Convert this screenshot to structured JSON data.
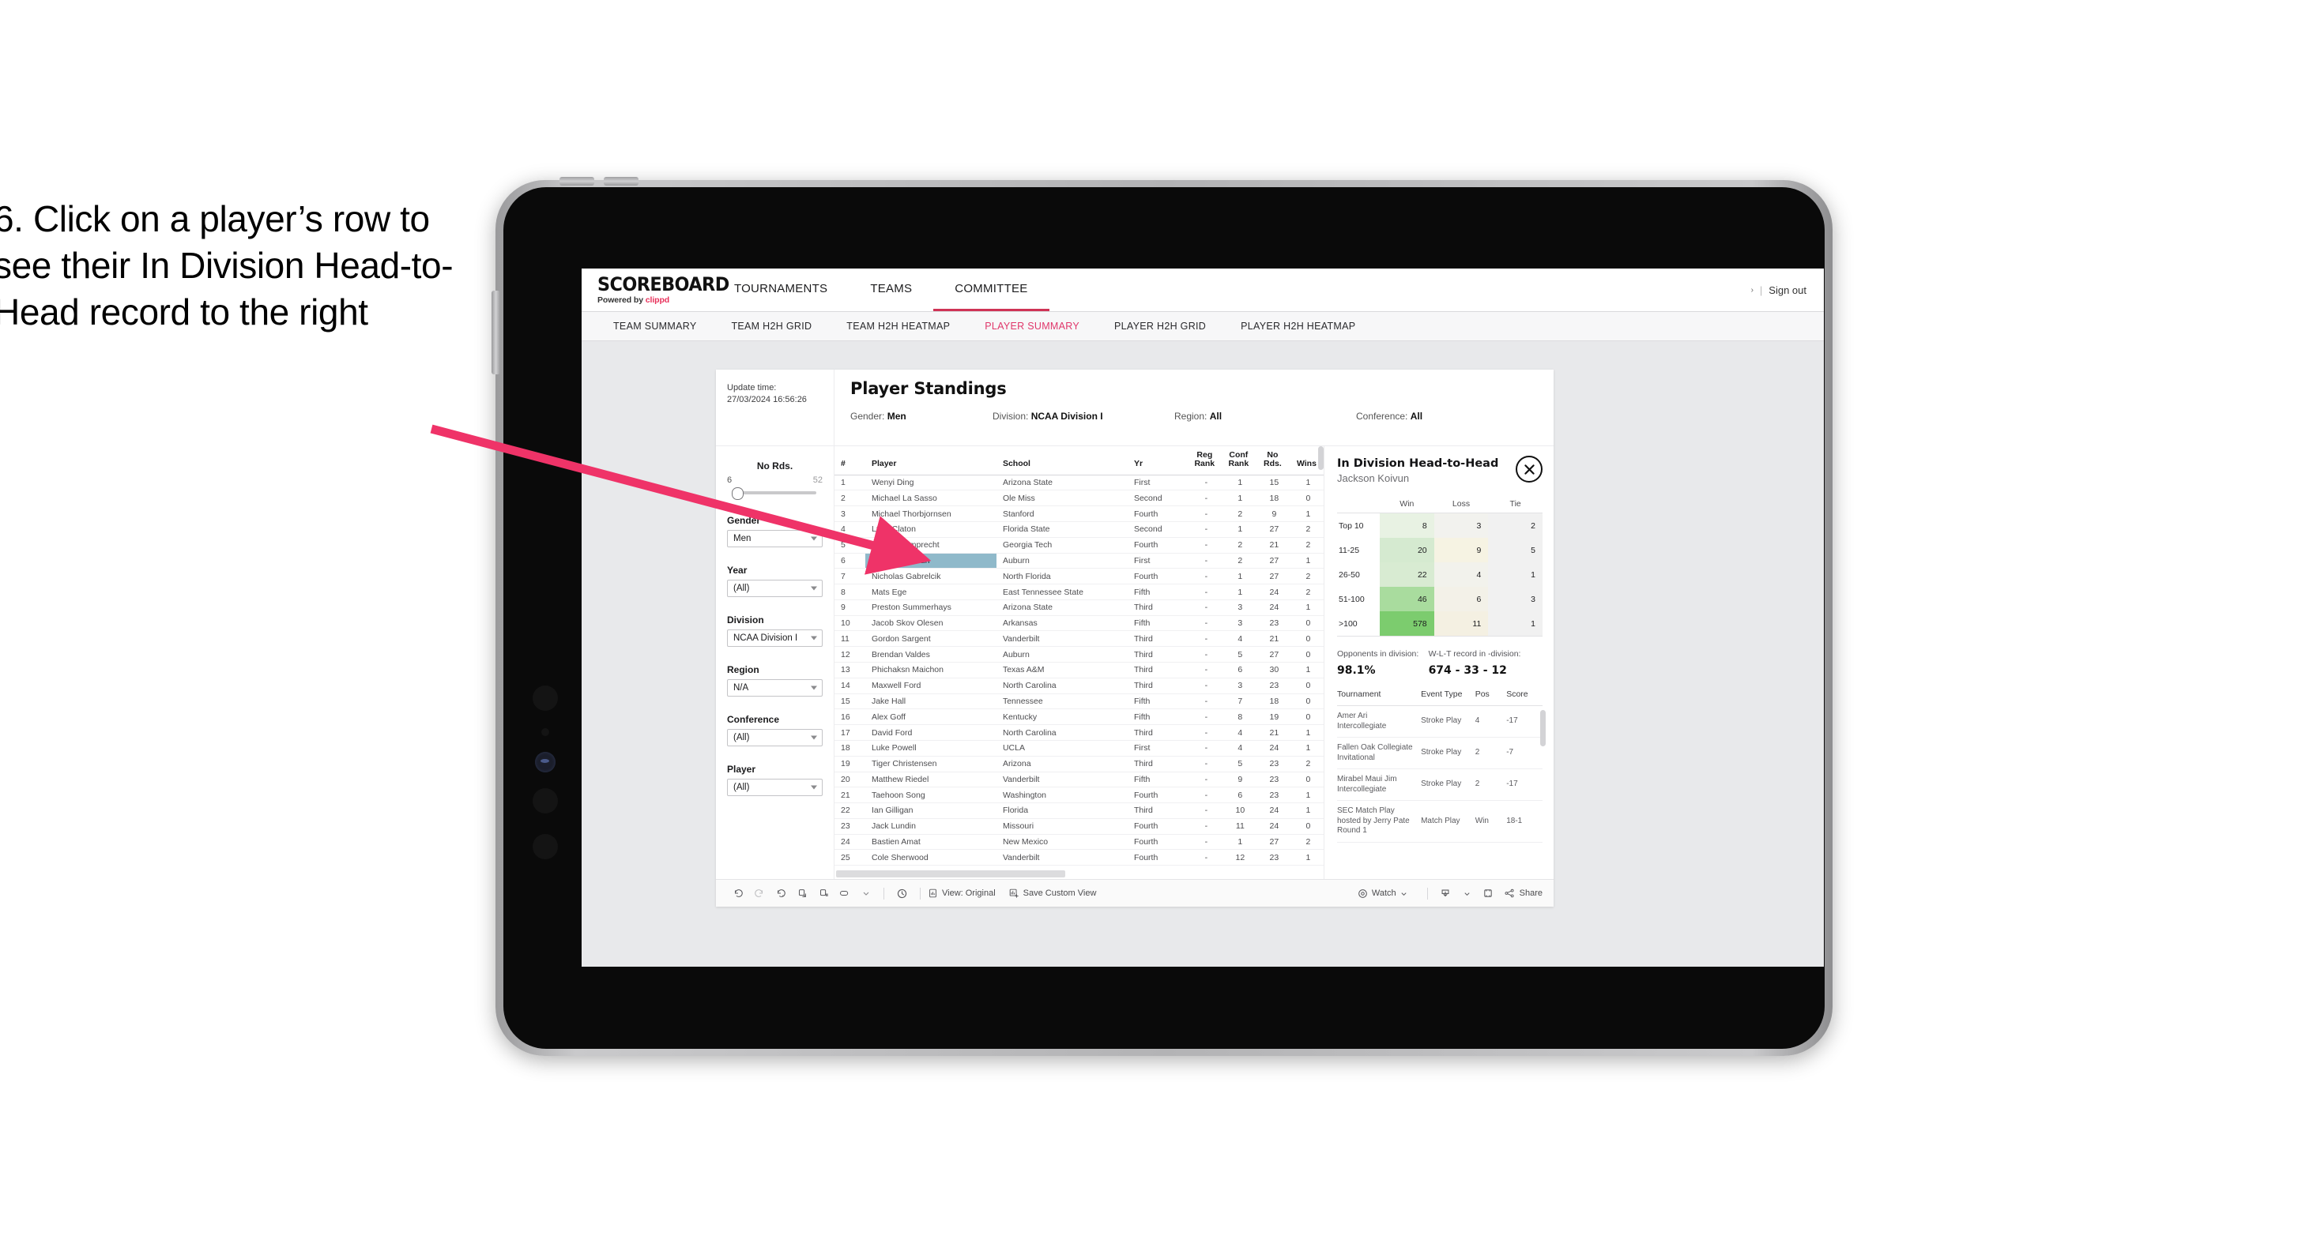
{
  "instruction": "6. Click on a player’s row to see their In Division Head-to-Head record to the right",
  "app": {
    "brand": {
      "name": "SCOREBOARD",
      "powered_prefix": "Powered by ",
      "powered_brand": "clippd"
    },
    "top_nav": [
      {
        "label": "TOURNAMENTS",
        "active": false
      },
      {
        "label": "TEAMS",
        "active": false
      },
      {
        "label": "COMMITTEE",
        "active": true
      }
    ],
    "account": {
      "chevron": "›",
      "separator": "|",
      "sign_out": "Sign out"
    },
    "sub_nav": [
      {
        "label": "TEAM SUMMARY",
        "active": false
      },
      {
        "label": "TEAM H2H GRID",
        "active": false
      },
      {
        "label": "TEAM H2H HEATMAP",
        "active": false
      },
      {
        "label": "PLAYER SUMMARY",
        "active": true
      },
      {
        "label": "PLAYER H2H GRID",
        "active": false
      },
      {
        "label": "PLAYER H2H HEATMAP",
        "active": false
      }
    ]
  },
  "card": {
    "update_time_label": "Update time:",
    "update_time_value": "27/03/2024 16:56:26",
    "title": "Player Standings",
    "crumbs": [
      {
        "key": "Gender: ",
        "value": "Men"
      },
      {
        "key": "Division: ",
        "value": "NCAA Division I"
      },
      {
        "key": "Region: ",
        "value": "All"
      },
      {
        "key": "Conference: ",
        "value": "All"
      }
    ]
  },
  "filters": {
    "slider": {
      "label": "No Rds.",
      "min": "6",
      "max": "52"
    },
    "selects": [
      {
        "label": "Gender",
        "value": "Men"
      },
      {
        "label": "Year",
        "value": "(All)"
      },
      {
        "label": "Division",
        "value": "NCAA Division I"
      },
      {
        "label": "Region",
        "value": "N/A"
      },
      {
        "label": "Conference",
        "value": "(All)"
      },
      {
        "label": "Player",
        "value": "(All)"
      }
    ]
  },
  "standings": {
    "columns": [
      "#",
      "Player",
      "School",
      "Yr",
      "Reg Rank",
      "Conf Rank",
      "No Rds.",
      "Wins"
    ],
    "column_lines": [
      [
        "#",
        ""
      ],
      [
        "Player",
        ""
      ],
      [
        "School",
        ""
      ],
      [
        "Yr",
        ""
      ],
      [
        "Reg",
        "Rank"
      ],
      [
        "Conf",
        "Rank"
      ],
      [
        "No",
        "Rds."
      ],
      [
        "Wins",
        ""
      ]
    ],
    "rows": [
      {
        "n": "1",
        "player": "Wenyi Ding",
        "school": "Arizona State",
        "yr": "First",
        "reg": "-",
        "conf": "1",
        "rds": "15",
        "wins": "1",
        "selected": false
      },
      {
        "n": "2",
        "player": "Michael La Sasso",
        "school": "Ole Miss",
        "yr": "Second",
        "reg": "-",
        "conf": "1",
        "rds": "18",
        "wins": "0",
        "selected": false
      },
      {
        "n": "3",
        "player": "Michael Thorbjornsen",
        "school": "Stanford",
        "yr": "Fourth",
        "reg": "-",
        "conf": "2",
        "rds": "9",
        "wins": "1",
        "selected": false
      },
      {
        "n": "4",
        "player": "Luke Claton",
        "school": "Florida State",
        "yr": "Second",
        "reg": "-",
        "conf": "1",
        "rds": "27",
        "wins": "2",
        "selected": false
      },
      {
        "n": "5",
        "player": "Christo Lamprecht",
        "school": "Georgia Tech",
        "yr": "Fourth",
        "reg": "-",
        "conf": "2",
        "rds": "21",
        "wins": "2",
        "selected": false
      },
      {
        "n": "6",
        "player": "Jackson Koivun",
        "school": "Auburn",
        "yr": "First",
        "reg": "-",
        "conf": "2",
        "rds": "27",
        "wins": "1",
        "selected": true
      },
      {
        "n": "7",
        "player": "Nicholas Gabrelcik",
        "school": "North Florida",
        "yr": "Fourth",
        "reg": "-",
        "conf": "1",
        "rds": "27",
        "wins": "2",
        "selected": false
      },
      {
        "n": "8",
        "player": "Mats Ege",
        "school": "East Tennessee State",
        "yr": "Fifth",
        "reg": "-",
        "conf": "1",
        "rds": "24",
        "wins": "2",
        "selected": false
      },
      {
        "n": "9",
        "player": "Preston Summerhays",
        "school": "Arizona State",
        "yr": "Third",
        "reg": "-",
        "conf": "3",
        "rds": "24",
        "wins": "1",
        "selected": false
      },
      {
        "n": "10",
        "player": "Jacob Skov Olesen",
        "school": "Arkansas",
        "yr": "Fifth",
        "reg": "-",
        "conf": "3",
        "rds": "23",
        "wins": "0",
        "selected": false
      },
      {
        "n": "11",
        "player": "Gordon Sargent",
        "school": "Vanderbilt",
        "yr": "Third",
        "reg": "-",
        "conf": "4",
        "rds": "21",
        "wins": "0",
        "selected": false
      },
      {
        "n": "12",
        "player": "Brendan Valdes",
        "school": "Auburn",
        "yr": "Third",
        "reg": "-",
        "conf": "5",
        "rds": "27",
        "wins": "0",
        "selected": false
      },
      {
        "n": "13",
        "player": "Phichaksn Maichon",
        "school": "Texas A&M",
        "yr": "Third",
        "reg": "-",
        "conf": "6",
        "rds": "30",
        "wins": "1",
        "selected": false
      },
      {
        "n": "14",
        "player": "Maxwell Ford",
        "school": "North Carolina",
        "yr": "Third",
        "reg": "-",
        "conf": "3",
        "rds": "23",
        "wins": "0",
        "selected": false
      },
      {
        "n": "15",
        "player": "Jake Hall",
        "school": "Tennessee",
        "yr": "Fifth",
        "reg": "-",
        "conf": "7",
        "rds": "18",
        "wins": "0",
        "selected": false
      },
      {
        "n": "16",
        "player": "Alex Goff",
        "school": "Kentucky",
        "yr": "Fifth",
        "reg": "-",
        "conf": "8",
        "rds": "19",
        "wins": "0",
        "selected": false
      },
      {
        "n": "17",
        "player": "David Ford",
        "school": "North Carolina",
        "yr": "Third",
        "reg": "-",
        "conf": "4",
        "rds": "21",
        "wins": "1",
        "selected": false
      },
      {
        "n": "18",
        "player": "Luke Powell",
        "school": "UCLA",
        "yr": "First",
        "reg": "-",
        "conf": "4",
        "rds": "24",
        "wins": "1",
        "selected": false
      },
      {
        "n": "19",
        "player": "Tiger Christensen",
        "school": "Arizona",
        "yr": "Third",
        "reg": "-",
        "conf": "5",
        "rds": "23",
        "wins": "2",
        "selected": false
      },
      {
        "n": "20",
        "player": "Matthew Riedel",
        "school": "Vanderbilt",
        "yr": "Fifth",
        "reg": "-",
        "conf": "9",
        "rds": "23",
        "wins": "0",
        "selected": false
      },
      {
        "n": "21",
        "player": "Taehoon Song",
        "school": "Washington",
        "yr": "Fourth",
        "reg": "-",
        "conf": "6",
        "rds": "23",
        "wins": "1",
        "selected": false
      },
      {
        "n": "22",
        "player": "Ian Gilligan",
        "school": "Florida",
        "yr": "Third",
        "reg": "-",
        "conf": "10",
        "rds": "24",
        "wins": "1",
        "selected": false
      },
      {
        "n": "23",
        "player": "Jack Lundin",
        "school": "Missouri",
        "yr": "Fourth",
        "reg": "-",
        "conf": "11",
        "rds": "24",
        "wins": "0",
        "selected": false
      },
      {
        "n": "24",
        "player": "Bastien Amat",
        "school": "New Mexico",
        "yr": "Fourth",
        "reg": "-",
        "conf": "1",
        "rds": "27",
        "wins": "2",
        "selected": false
      },
      {
        "n": "25",
        "player": "Cole Sherwood",
        "school": "Vanderbilt",
        "yr": "Fourth",
        "reg": "-",
        "conf": "12",
        "rds": "23",
        "wins": "1",
        "selected": false
      }
    ]
  },
  "h2h": {
    "title": "In Division Head-to-Head",
    "player": "Jackson Koivun",
    "close_icon": "close-circle-icon",
    "columns": [
      "",
      "Win",
      "Loss",
      "Tie"
    ],
    "rows": [
      {
        "band": "Top 10",
        "win": "8",
        "loss": "3",
        "tie": "2",
        "win_color": "#e8f2e3",
        "loss_color": "#f2f2ee",
        "tie_color": "#f1f1f1"
      },
      {
        "band": "11-25",
        "win": "20",
        "loss": "9",
        "tie": "5",
        "win_color": "#d5ead0",
        "loss_color": "#f6f3e3",
        "tie_color": "#f1f1f1"
      },
      {
        "band": "26-50",
        "win": "22",
        "loss": "4",
        "tie": "1",
        "win_color": "#d8ebd2",
        "loss_color": "#f2f2ec",
        "tie_color": "#f1f1f1"
      },
      {
        "band": "51-100",
        "win": "46",
        "loss": "6",
        "tie": "3",
        "win_color": "#a9dc9e",
        "loss_color": "#f3f1e8",
        "tie_color": "#f1f1f1"
      },
      {
        "band": ">100",
        "win": "578",
        "loss": "11",
        "tie": "1",
        "win_color": "#7ccc6e",
        "loss_color": "#f4f0e2",
        "tie_color": "#f1f1f1"
      }
    ],
    "summary": [
      {
        "key": "Opponents in division:",
        "value": "98.1%"
      },
      {
        "key": "W-L-T record in -division:",
        "value": "674 - 33 - 12"
      }
    ],
    "tournaments": {
      "columns": [
        "Tournament",
        "Event Type",
        "Pos",
        "Score"
      ],
      "rows": [
        {
          "tournament": "Amer Ari Intercollegiate",
          "event": "Stroke Play",
          "pos": "4",
          "score": "-17"
        },
        {
          "tournament": "Fallen Oak Collegiate Invitational",
          "event": "Stroke Play",
          "pos": "2",
          "score": "-7"
        },
        {
          "tournament": "Mirabel Maui Jim Intercollegiate",
          "event": "Stroke Play",
          "pos": "2",
          "score": "-17"
        },
        {
          "tournament": "SEC Match Play hosted by Jerry Pate Round 1",
          "event": "Match Play",
          "pos": "Win",
          "score": "18-1"
        }
      ]
    }
  },
  "toolbar": {
    "icons": [
      "undo-icon",
      "redo-icon",
      "revert-icon",
      "refresh-data-icon",
      "pause-refresh-icon",
      "pill-icon",
      "chevron-down-icon",
      "clock-history-icon"
    ],
    "view_label": "View: Original",
    "save_label": "Save Custom View",
    "watch_label": "Watch",
    "share_label": "Share",
    "download_icon": "download-icon",
    "fullscreen_icon": "fullscreen-icon",
    "share_icon": "share-icon",
    "watch_icon": "watch-icon",
    "view_icon": "view-original-icon",
    "save_icon": "save-view-icon"
  },
  "colors": {
    "accent": "#cf3355",
    "subnav_active": "#e0376b",
    "selected_row": "#8fb9ca",
    "arrow": "#ef3368"
  }
}
